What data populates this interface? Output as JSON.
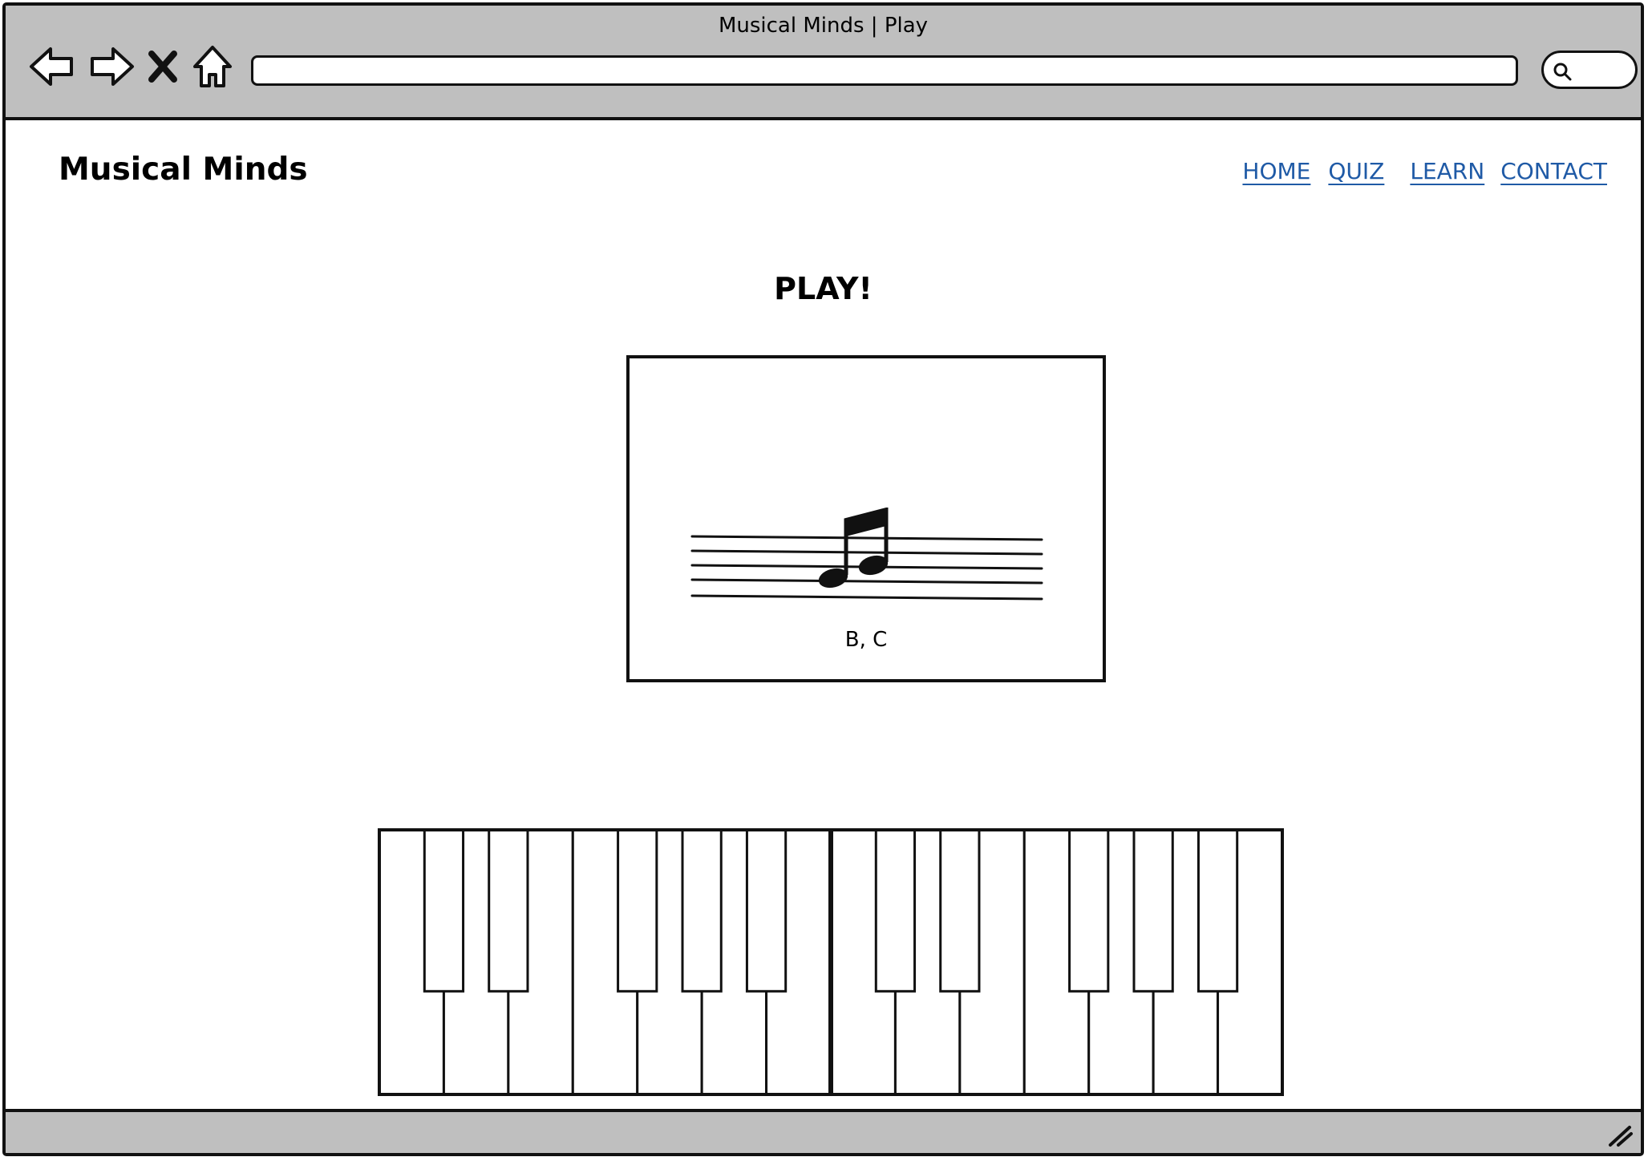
{
  "window": {
    "title": "Musical Minds | Play"
  },
  "toolbar": {
    "back_icon": "back-arrow-icon",
    "forward_icon": "forward-arrow-icon",
    "stop_icon": "close-x-icon",
    "home_icon": "home-icon",
    "search_icon": "magnifier-icon",
    "address_value": ""
  },
  "header": {
    "brand": "Musical Minds",
    "nav": [
      {
        "label": "HOME"
      },
      {
        "label": "QUIZ"
      },
      {
        "label": "LEARN"
      },
      {
        "label": "CONTACT"
      }
    ],
    "link_color": "#1f5aa6"
  },
  "main": {
    "heading": "PLAY!",
    "card": {
      "image": "staff-with-eighth-notes-icon",
      "notes_label": "B, C"
    }
  },
  "piano": {
    "octaves": 2,
    "white_keys_per_octave": 7,
    "black_key_pattern": [
      1,
      1,
      0,
      1,
      1,
      1,
      0
    ]
  },
  "colors": {
    "chrome": "#bfbfbf",
    "ink": "#111111",
    "background": "#ffffff"
  }
}
